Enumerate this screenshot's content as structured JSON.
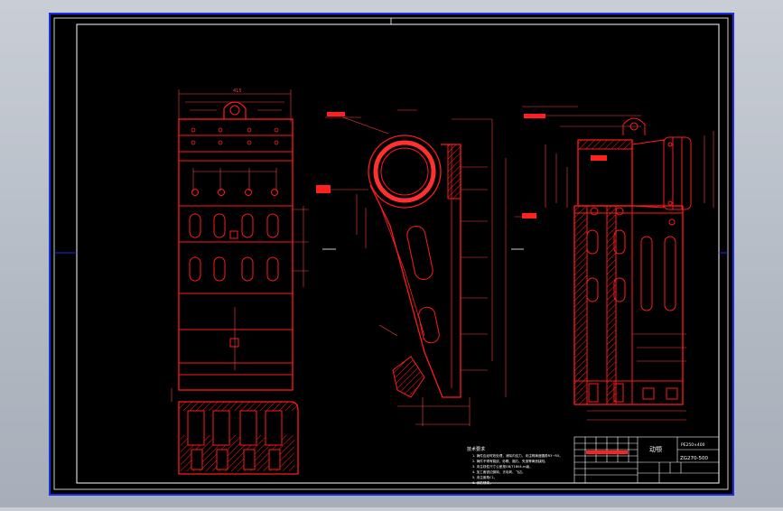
{
  "drawing": {
    "notes_title": "技术要求",
    "notes": [
      "1. 铸件应经时效处理，消除内应力，未注明铸造圆角R3~R5。",
      "2. 铸件不得有裂纹、砂眼、缩孔、夹渣等铸造缺陷。",
      "3. 未注线性尺寸公差按GB/T1804-m级。",
      "4. 加工面锐边倒钝，去毛刺、飞边。",
      "5. 未注倒角C1。",
      "6. 涂防锈漆。"
    ],
    "title_block": {
      "part_name": "动颚",
      "drawing_no": "ZG270-500",
      "code_label": "PE250×400"
    },
    "colors": {
      "background": "#000000",
      "line": "#ffffff",
      "geometry": "#ff1a1a",
      "frame_outer": "#1a2ee6"
    }
  }
}
